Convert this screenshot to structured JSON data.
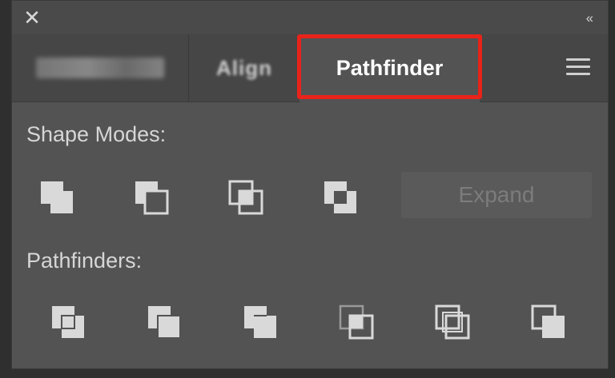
{
  "window": {
    "close_glyph": "✕",
    "collapse_glyph": "‹‹"
  },
  "tabs": {
    "align_label": "Align",
    "pathfinder_label": "Pathfinder"
  },
  "shape_modes": {
    "label": "Shape Modes:",
    "buttons": [
      "unite",
      "minus-front",
      "intersect",
      "exclude"
    ],
    "expand_label": "Expand"
  },
  "pathfinders": {
    "label": "Pathfinders:",
    "buttons": [
      "divide",
      "trim",
      "merge",
      "crop",
      "outline",
      "minus-back"
    ]
  },
  "colors": {
    "panel_bg": "#535353",
    "icon_fill": "#d9d9d9",
    "highlight": "#e8231a"
  }
}
